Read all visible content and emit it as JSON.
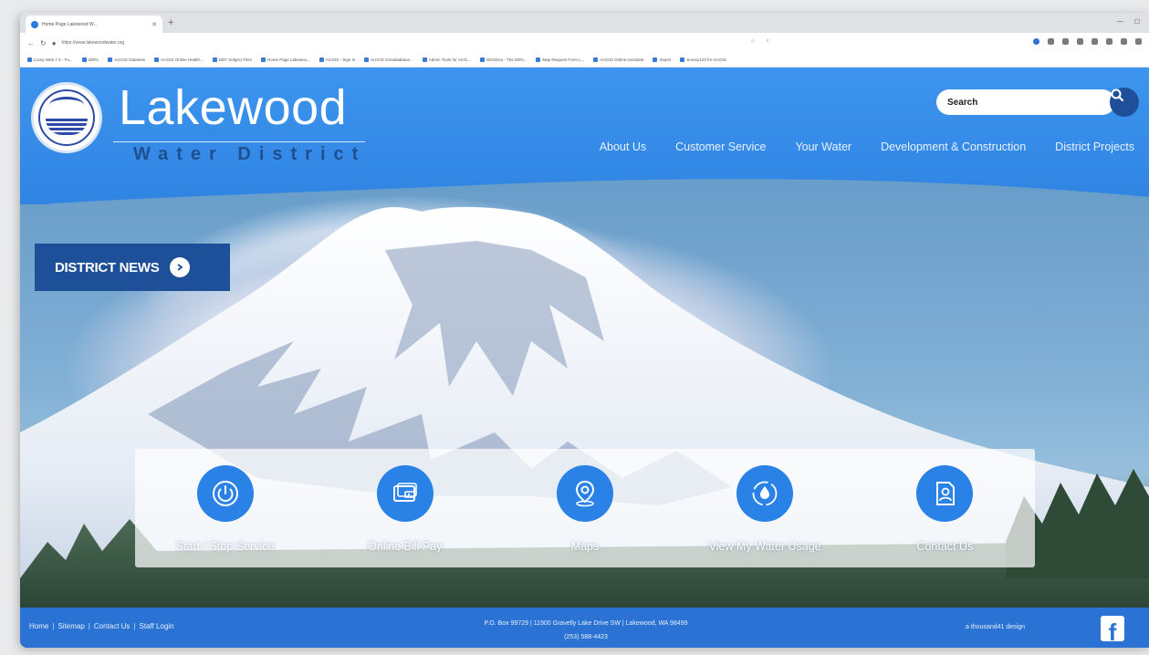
{
  "browser": {
    "tab_title": "Home Page Lakewood W...",
    "url": "https://www.lakewoodwater.org",
    "bookmarks": [
      "Lucity Web 7.3 - Fu...",
      "DDFL",
      "ArcGIS Datasets",
      "ArcGIS Online Health...",
      "DDT Subject Files",
      "Home Page Lakewoo...",
      "ArcGIS - Sign In",
      "ArcGIS Geodatabase...",
      "Admin Tools for ArcG...",
      "ODNGeo - The DEN...",
      "Map Request Form L...",
      "ArcGIS Online Assistant",
      "Import",
      "Survey123 for ArcGIS"
    ]
  },
  "header": {
    "title": "Lakewood",
    "subtitle": "Water District",
    "search_placeholder": "Search",
    "nav": [
      "About Us",
      "Customer Service",
      "Your Water",
      "Development & Construction",
      "District Projects"
    ]
  },
  "hero": {
    "news_label": "DISTRICT NEWS"
  },
  "quick_links": [
    {
      "label": "Start / Stop Service",
      "icon": "power-icon"
    },
    {
      "label": "Online Bill Pay",
      "icon": "wallet-icon"
    },
    {
      "label": "Maps",
      "icon": "map-pin-icon"
    },
    {
      "label": "View My Water Usage",
      "icon": "water-drop-icon"
    },
    {
      "label": "Contact Us",
      "icon": "contact-card-icon"
    }
  ],
  "footer": {
    "links": [
      "Home",
      "Sitemap",
      "Contact Us",
      "Staff Login"
    ],
    "address_line1": "P.O. Box 99729  |  11900 Gravelly Lake Drive SW  |  Lakewood, WA 98499",
    "address_line2": "(253) 588-4423",
    "credit": "a thousand41 design",
    "facebook": "f"
  },
  "colors": {
    "header_blue": "#3a8fe8",
    "dark_blue": "#1e4f99",
    "icon_blue": "#2a82e6",
    "footer_blue": "#2a73d4"
  }
}
